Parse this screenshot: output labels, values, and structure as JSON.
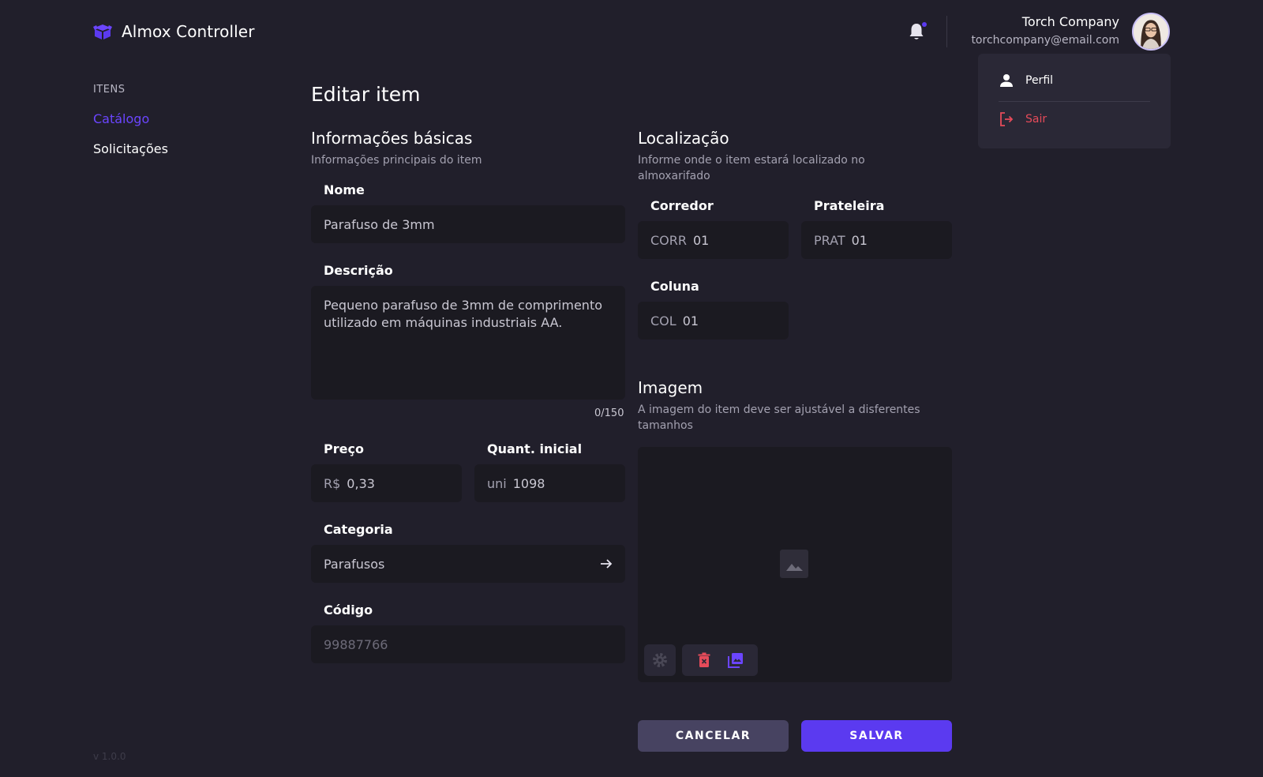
{
  "app": {
    "title": "Almox Controller",
    "version": "v 1.0.0"
  },
  "user": {
    "name": "Torch Company",
    "email": "torchcompany@email.com"
  },
  "dropdown": {
    "profile_label": "Perfil",
    "logout_label": "Sair"
  },
  "sidebar": {
    "section": "ITENS",
    "items": [
      {
        "label": "Catálogo",
        "active": true
      },
      {
        "label": "Solicitações",
        "active": false
      }
    ]
  },
  "page": {
    "title": "Editar item"
  },
  "basic_info": {
    "title": "Informações básicas",
    "subtitle": "Informações principais do item",
    "name_label": "Nome",
    "name_value": "Parafuso de 3mm",
    "description_label": "Descrição",
    "description_value": "Pequeno parafuso de 3mm de comprimento utilizado em máquinas industriais AA.",
    "description_counter": "0/150",
    "price_label": "Preço",
    "price_prefix": "R$",
    "price_value": "0,33",
    "qty_label": "Quant. inicial",
    "qty_prefix": "uni",
    "qty_value": "1098",
    "category_label": "Categoria",
    "category_value": "Parafusos",
    "code_label": "Código",
    "code_placeholder": "99887766"
  },
  "location": {
    "title": "Localização",
    "subtitle": "Informe onde o item estará localizado no almoxarifado",
    "corridor_label": "Corredor",
    "corridor_prefix": "CORR",
    "corridor_value": "01",
    "shelf_label": "Prateleira",
    "shelf_prefix": "PRAT",
    "shelf_value": "01",
    "column_label": "Coluna",
    "column_prefix": "COL",
    "column_value": "01"
  },
  "image": {
    "title": "Imagem",
    "subtitle": "A imagem do item deve ser ajustável a disferentes tamanhos"
  },
  "actions": {
    "cancel_label": "CANCELAR",
    "save_label": "SALVAR"
  },
  "colors": {
    "background": "#211f2b",
    "field": "#1b1a21",
    "accent": "#5b3af0",
    "active_link": "#6b45ff",
    "danger": "#e64b5a",
    "cancel_button": "#474361"
  }
}
